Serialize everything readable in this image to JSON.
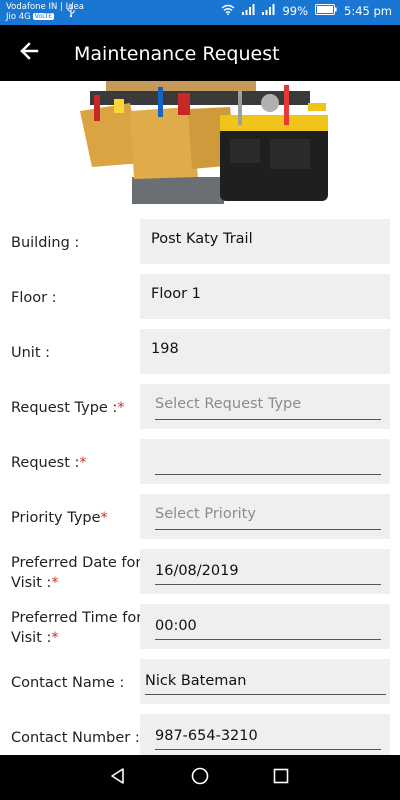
{
  "status_bar": {
    "carrier_line1": "Vodafone IN | Idea",
    "carrier_line2": "Jio 4G",
    "volte": "VoLTE",
    "battery": "99%",
    "time": "5:45 pm"
  },
  "header": {
    "title": "Maintenance Request"
  },
  "form": {
    "building": {
      "label": "Building :",
      "value": "Post Katy Trail"
    },
    "floor": {
      "label": "Floor :",
      "value": "Floor 1"
    },
    "unit": {
      "label": "Unit :",
      "value": "198"
    },
    "request_type": {
      "label": "Request Type :",
      "required": "*",
      "placeholder": "Select Request Type"
    },
    "request": {
      "label": "Request :",
      "required": "*",
      "value": ""
    },
    "priority_type": {
      "label": "Priority Type",
      "required": "*",
      "placeholder": "Select Priority"
    },
    "preferred_date": {
      "label_line1": "Preferred Date for",
      "label_line2": "Visit :",
      "required": "*",
      "value": "16/08/2019"
    },
    "preferred_time": {
      "label_line1": "Preferred Time for",
      "label_line2": "Visit :",
      "required": "*",
      "value": "00:00"
    },
    "contact_name": {
      "label": "Contact Name :",
      "value": "Nick Bateman"
    },
    "contact_number": {
      "label": "Contact Number :",
      "value": "987-654-3210"
    }
  },
  "colors": {
    "status_bar": "#1976d2",
    "app_bar": "#000000",
    "field_bg": "#efefef",
    "required": "#d32f2f"
  },
  "icons": {
    "back": "arrow-left-icon",
    "nav_back": "triangle-back-icon",
    "nav_home": "circle-home-icon",
    "nav_recent": "square-recent-icon"
  }
}
